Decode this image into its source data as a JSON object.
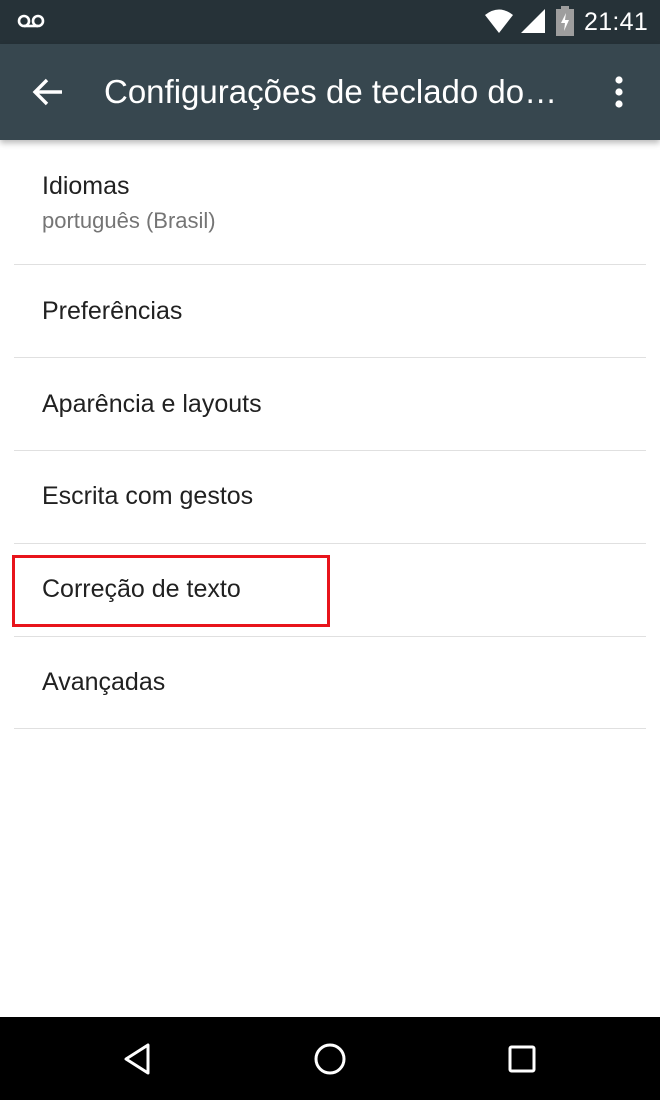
{
  "status_bar": {
    "time": "21:41",
    "icons": [
      "voicemail-icon",
      "wifi-icon",
      "signal-icon",
      "battery-charging-icon"
    ]
  },
  "app_bar": {
    "title": "Configurações de teclado do…",
    "back_icon": "arrow-left-icon",
    "menu_icon": "overflow-menu-icon"
  },
  "settings": {
    "items": [
      {
        "label": "Idiomas",
        "summary": "português (Brasil)"
      },
      {
        "label": "Preferências"
      },
      {
        "label": "Aparência e layouts"
      },
      {
        "label": "Escrita com gestos"
      },
      {
        "label": "Correção de texto",
        "highlighted": true
      },
      {
        "label": "Avançadas"
      }
    ]
  },
  "highlight_color": "#e8141b",
  "nav_bar": {
    "buttons": [
      "back-triangle-icon",
      "home-circle-icon",
      "recents-square-icon"
    ]
  }
}
